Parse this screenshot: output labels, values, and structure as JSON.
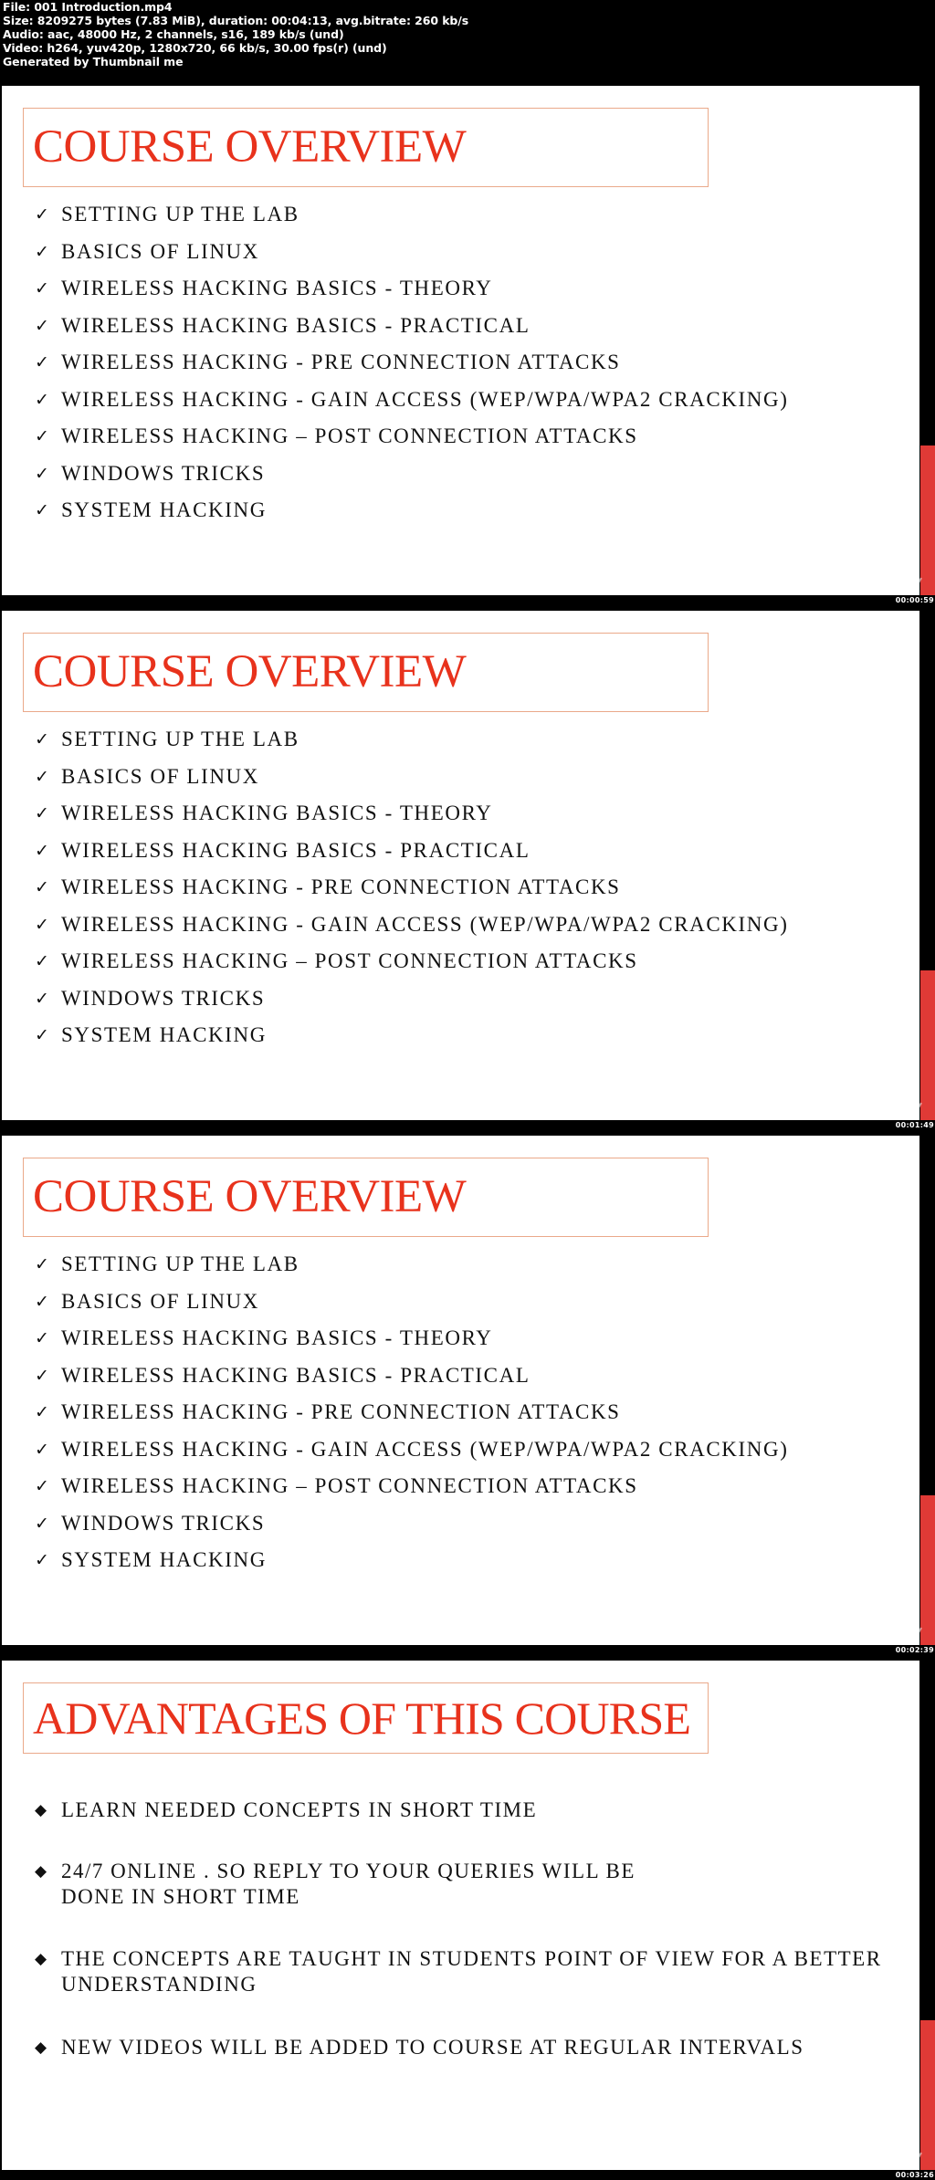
{
  "info": {
    "file": "File: 001 Introduction.mp4",
    "size": "Size: 8209275 bytes (7.83 MiB), duration: 00:04:13, avg.bitrate: 260 kb/s",
    "audio": "Audio: aac, 48000 Hz, 2 channels, s16, 189 kb/s (und)",
    "video": "Video: h264, yuv420p, 1280x720, 66 kb/s, 30.00 fps(r) (und)",
    "generator": "Generated by Thumbnail me"
  },
  "overview": {
    "title": "COURSE OVERVIEW",
    "check_glyph": "✓",
    "items": [
      "SETTING UP THE LAB",
      "BASICS OF LINUX",
      "WIRELESS HACKING BASICS - THEORY",
      "WIRELESS HACKING BASICS - PRACTICAL",
      "WIRELESS HACKING - PRE CONNECTION ATTACKS",
      "WIRELESS HACKING - GAIN ACCESS (WEP/WPA/WPA2 CRACKING)",
      "WIRELESS HACKING – POST CONNECTION ATTACKS",
      "WINDOWS TRICKS",
      "SYSTEM HACKING"
    ]
  },
  "advantages": {
    "title": "ADVANTAGES OF THIS COURSE",
    "bullet_glyph": "◆",
    "items": [
      "LEARN NEEDED CONCEPTS IN SHORT TIME",
      "24/7 ONLINE . SO REPLY TO YOUR QUERIES WILL BE DONE IN SHORT TIME",
      "THE CONCEPTS ARE TAUGHT IN STUDENTS POINT OF VIEW FOR A BETTER UNDERSTANDING",
      "NEW VIDEOS WILL BE ADDED TO COURSE AT REGULAR INTERVALS"
    ]
  },
  "frames": [
    {
      "timestamp": "00:00:59"
    },
    {
      "timestamp": "00:01:49"
    },
    {
      "timestamp": "00:02:39"
    },
    {
      "timestamp": "00:03:26"
    }
  ],
  "colors": {
    "title_red": "#e8321c",
    "title_border": "#eaa98a",
    "accent_bar": "#e03a36"
  }
}
